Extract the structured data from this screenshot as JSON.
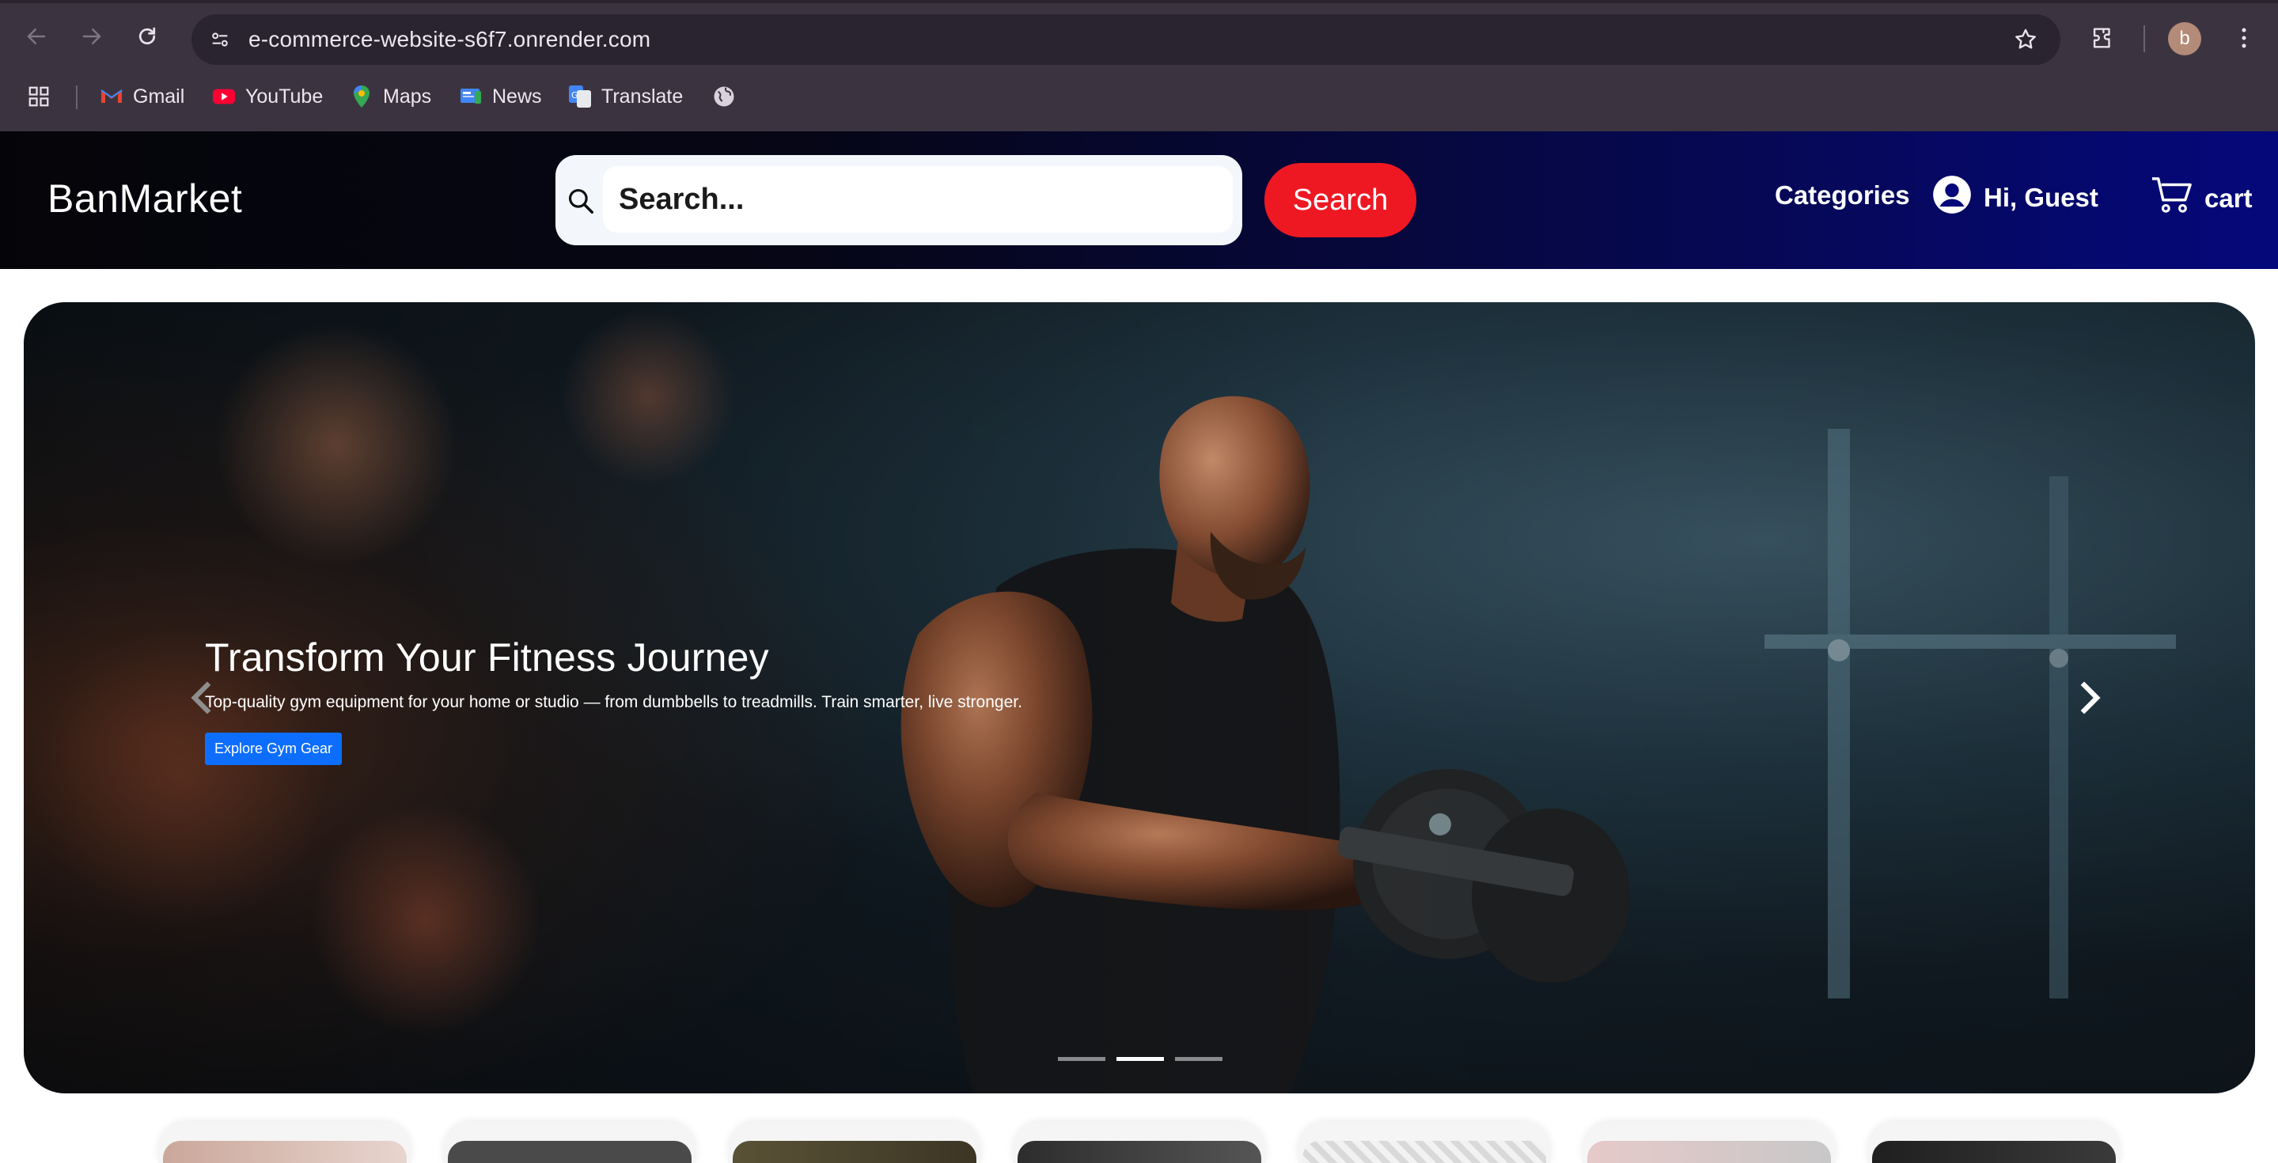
{
  "browser": {
    "url": "e-commerce-website-s6f7.onrender.com",
    "profile_initial": "b",
    "bookmarks": [
      {
        "label": "Gmail",
        "icon": "gmail-icon"
      },
      {
        "label": "YouTube",
        "icon": "youtube-icon"
      },
      {
        "label": "Maps",
        "icon": "maps-icon"
      },
      {
        "label": "News",
        "icon": "news-icon"
      },
      {
        "label": "Translate",
        "icon": "translate-icon"
      }
    ]
  },
  "header": {
    "brand": "BanMarket",
    "search": {
      "placeholder": "Search...",
      "button_label": "Search"
    },
    "categories_label": "Categories",
    "user_label": "Hi, Guest",
    "cart_label": "cart"
  },
  "hero": {
    "title": "Transform Your Fitness Journey",
    "subtitle": "Top-quality gym equipment for your home or studio — from dumbbells to treadmills. Train smarter, live stronger.",
    "cta_label": "Explore Gym Gear",
    "slide_count": 3,
    "active_slide": 2
  },
  "colors": {
    "search_button": "#ee1823",
    "cta_button": "#0d6efd",
    "header_gradient_end": "#05087a"
  }
}
